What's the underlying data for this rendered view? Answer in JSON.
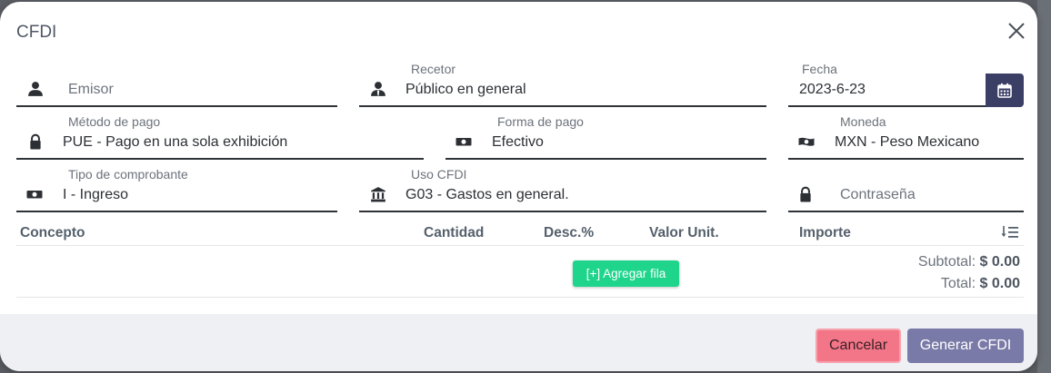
{
  "modal": {
    "title": "CFDI"
  },
  "fields": {
    "emisor": {
      "placeholder": "Emisor",
      "value": ""
    },
    "receptor": {
      "label": "Recetor",
      "value": "Público en general"
    },
    "fecha": {
      "label": "Fecha",
      "value": "2023-6-23"
    },
    "metodo_pago": {
      "label": "Método de pago",
      "value": "PUE - Pago en una sola exhibición"
    },
    "forma_pago": {
      "label": "Forma de pago",
      "value": "Efectivo"
    },
    "moneda": {
      "label": "Moneda",
      "value": "MXN - Peso Mexicano"
    },
    "tipo_comprobante": {
      "label": "Tipo de comprobante",
      "value": "I - Ingreso"
    },
    "uso_cfdi": {
      "label": "Uso CFDI",
      "value": "G03 - Gastos en general."
    },
    "contrasena": {
      "placeholder": "Contraseña",
      "value": ""
    }
  },
  "table": {
    "headers": [
      "Concepto",
      "Cantidad",
      "Desc.%",
      "Valor Unit.",
      "Importe"
    ],
    "add_row_label": "[+] Agregar fila",
    "subtotal_label": "Subtotal:",
    "subtotal_value": "$ 0.00",
    "total_label": "Total:",
    "total_value": "$ 0.00"
  },
  "footer": {
    "cancel_label": "Cancelar",
    "generate_label": "Generar CFDI"
  },
  "colors": {
    "accent": "#3b3f66",
    "add_row": "#1fd58c",
    "cancel": "#f27588",
    "generate": "#7a7aa8"
  }
}
